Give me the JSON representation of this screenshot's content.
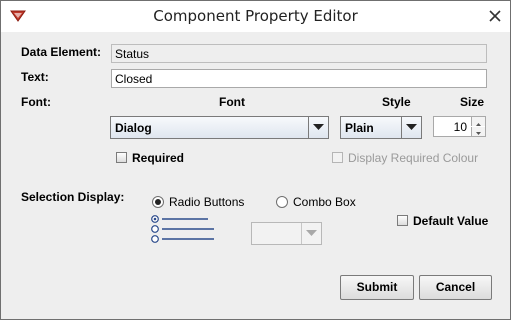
{
  "window": {
    "title": "Component Property Editor"
  },
  "form": {
    "data_element_label": "Data Element:",
    "data_element_value": "Status",
    "text_label": "Text:",
    "text_value": "Closed",
    "font_label": "Font:",
    "font_header": "Font",
    "style_header": "Style",
    "size_header": "Size",
    "font_value": "Dialog",
    "style_value": "Plain",
    "size_value": "10",
    "required_label": "Required",
    "required_checked": false,
    "display_required_colour_label": "Display Required Colour",
    "display_required_colour_checked": false,
    "selection_display_label": "Selection Display:",
    "radio_buttons_label": "Radio Buttons",
    "radio_buttons_selected": true,
    "combo_box_label": "Combo Box",
    "combo_box_selected": false,
    "default_value_label": "Default Value",
    "default_value_checked": false,
    "default_value_combo_value": ""
  },
  "buttons": {
    "submit": "Submit",
    "cancel": "Cancel"
  },
  "colors": {
    "accent_red": "#c0392b",
    "close_red": "#c43c2c"
  }
}
